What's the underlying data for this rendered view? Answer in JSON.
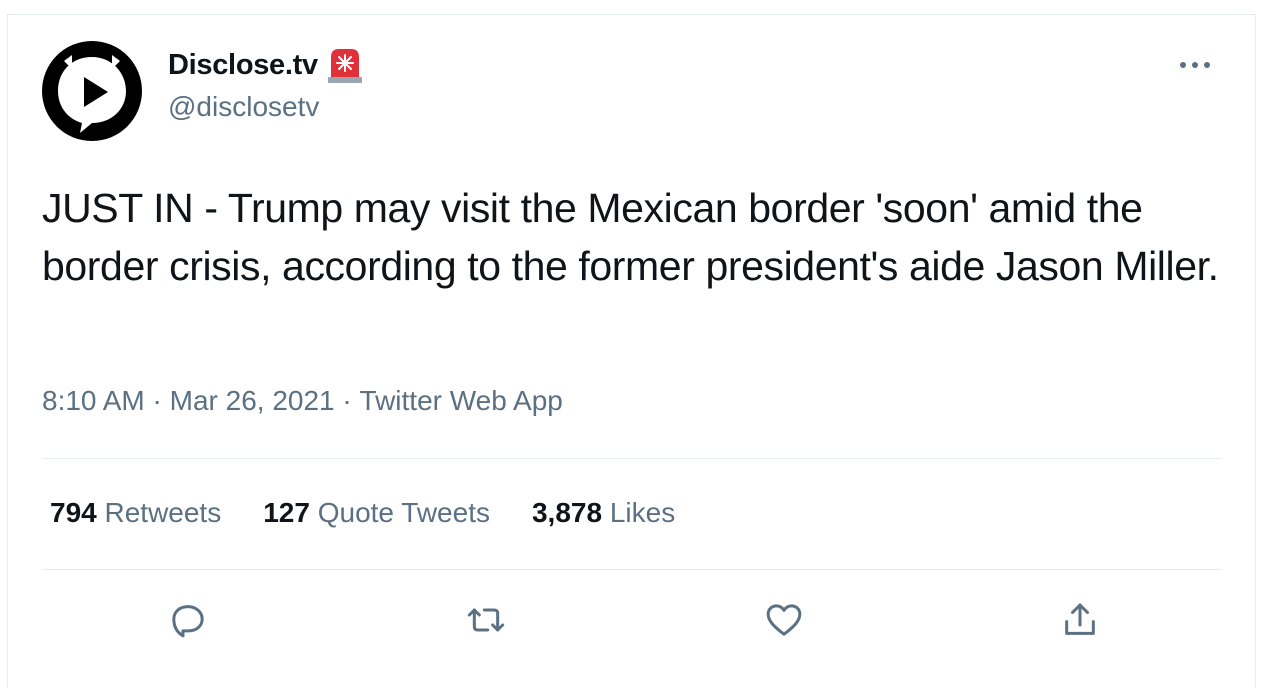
{
  "tweet": {
    "author": {
      "display_name": "Disclose.tv",
      "handle": "@disclosetv"
    },
    "text": "JUST IN - Trump may visit the Mexican border 'soon' amid the border crisis, according to the former president's aide Jason Miller.",
    "time": "8:10 AM",
    "separator1": " · ",
    "date": "Mar 26, 2021",
    "separator2": " · ",
    "source": "Twitter Web App",
    "stats": {
      "retweets": {
        "count": "794",
        "label": " Retweets"
      },
      "quotes": {
        "count": "127",
        "label": " Quote Tweets"
      },
      "likes": {
        "count": "3,878",
        "label": " Likes"
      }
    },
    "icons": {
      "more": "more-horizontal-icon",
      "reply": "reply-icon",
      "retweet": "retweet-icon",
      "like": "heart-icon",
      "share": "share-icon",
      "emoji": "police-siren-icon"
    }
  },
  "colors": {
    "text": "#0f1419",
    "secondary": "#5b7083",
    "border": "#e6ecf0",
    "siren_red": "#e0303a"
  }
}
